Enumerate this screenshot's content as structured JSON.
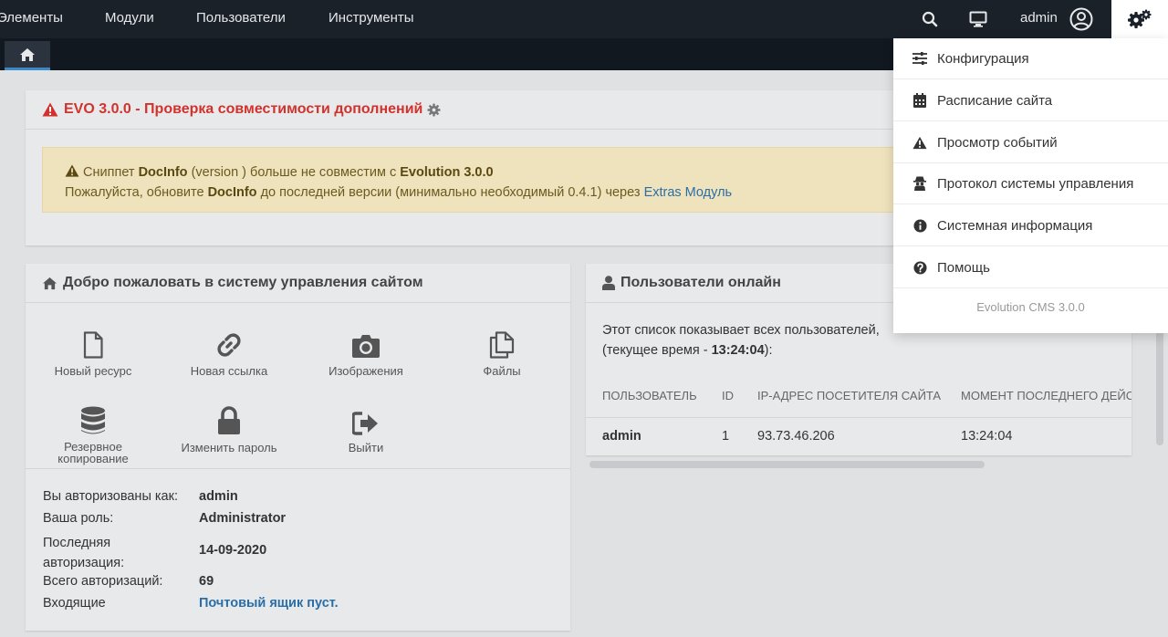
{
  "topnav": {
    "items": [
      "Элементы",
      "Модули",
      "Пользователи",
      "Инструменты"
    ],
    "user_label": "admin"
  },
  "alert": {
    "title": "EVO 3.0.0 - Проверка совместимости дополнений",
    "line1_prefix": "Сниппет",
    "line1_name": "DocInfo",
    "line1_mid": "(version ) больше не совместим с",
    "line1_version": "Evolution 3.0.0",
    "line2_prefix": "Пожалуйста, обновите",
    "line2_name": "DocInfo",
    "line2_mid": "до последней версии (минимально необходимый 0.4.1) через",
    "line2_link": "Extras Модуль"
  },
  "welcome": {
    "title": "Добро пожаловать в систему управления сайтом",
    "quick": {
      "new_resource": "Новый ресурс",
      "new_link": "Новая ссылка",
      "images": "Изображения",
      "files": "Файлы",
      "backup_1": "Резервное",
      "backup_2": "копирование",
      "change_password": "Изменить пароль",
      "logout": "Выйти"
    },
    "info": {
      "logged_as_label": "Вы авторизованы как:",
      "logged_as_value": "admin",
      "role_label": "Ваша роль:",
      "role_value": "Administrator",
      "last_login_label_1": "Последняя",
      "last_login_label_2": "авторизация:",
      "last_login_value": "14-09-2020",
      "total_logins_label": "Всего авторизаций:",
      "total_logins_value": "69",
      "inbox_label": "Входящие",
      "inbox_value": "Почтовый ящик пуст."
    }
  },
  "online": {
    "title": "Пользователи онлайн",
    "desc_line1": "Этот список показывает всех пользователей,",
    "desc_line2_prefix": "(текущее время -",
    "desc_time": "13:24:04",
    "desc_line2_suffix": "):",
    "columns": [
      "Пользователь",
      "ID",
      "IP-адрес посетителя сайта",
      "Момент последнего действия"
    ],
    "rows": [
      {
        "user": "admin",
        "id": "1",
        "ip": "93.73.46.206",
        "time": "13:24:04"
      }
    ]
  },
  "dropdown": {
    "items": [
      "Конфигурация",
      "Расписание сайта",
      "Просмотр событий",
      "Протокол системы управления",
      "Системная информация",
      "Помощь"
    ],
    "footer": "Evolution CMS 3.0.0"
  },
  "colors": {
    "topbar": "#1b2129",
    "alert_red": "#d2322d",
    "link_blue": "#2a6ea8",
    "warning_bg": "#efe3bd"
  }
}
